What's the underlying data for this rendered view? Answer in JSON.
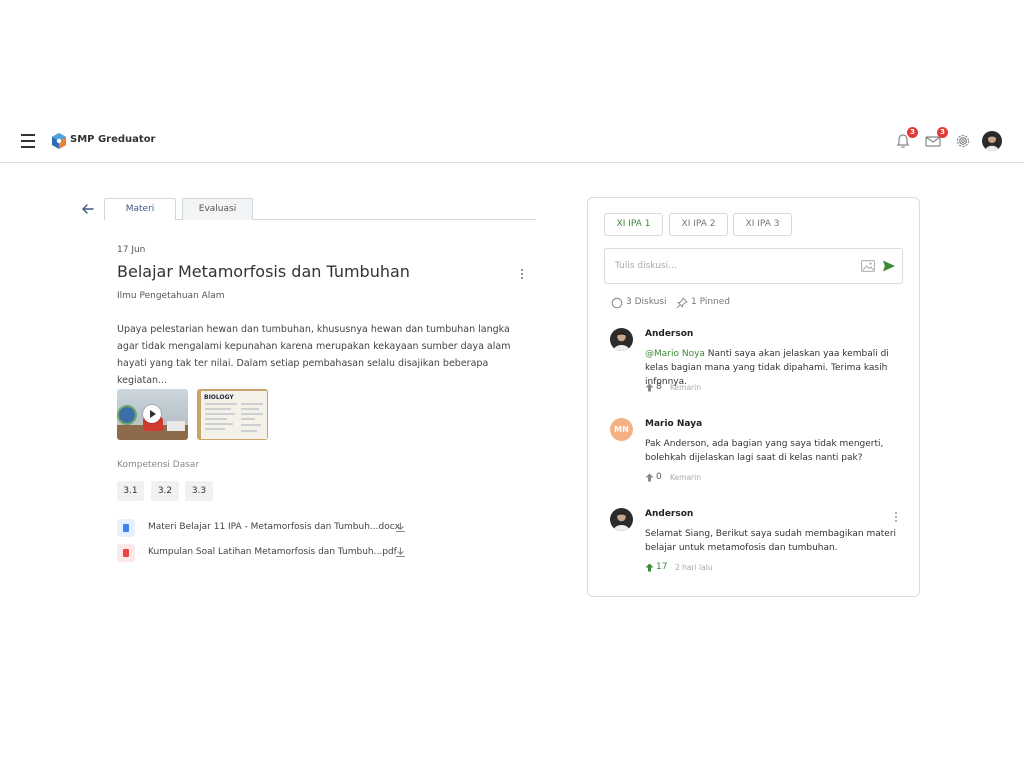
{
  "header": {
    "app_title": "SMP Greduator",
    "notifications_count": "3",
    "messages_count": "3"
  },
  "tabs": [
    {
      "label": "Materi",
      "active": true
    },
    {
      "label": "Evaluasi",
      "active": false
    }
  ],
  "material": {
    "date": "17 Jun",
    "title": "Belajar Metamorfosis dan Tumbuhan",
    "subject": "Ilmu Pengetahuan Alam",
    "description": "Upaya pelestarian hewan dan tumbuhan, khususnya hewan dan tumbuhan langka agar tidak mengalami kepunahan karena merupakan kekayaan sumber daya alam hayati yang tak ter nilai. Dalam setiap pembahasan selalu disajikan beberapa kegiatan...",
    "thumb_text": "BIOLOGY",
    "competency_label": "Kompetensi Dasar",
    "competencies": [
      "3.1",
      "3.2",
      "3.3"
    ],
    "files": [
      {
        "name": "Materi Belajar 11 IPA - Metamorfosis dan Tumbuh...docx",
        "type": "docx",
        "color": "#3b82f6"
      },
      {
        "name": "Kumpulan Soal Latihan Metamorfosis dan Tumbuh...pdf",
        "type": "pdf",
        "color": "#ef4444"
      }
    ]
  },
  "discussion": {
    "class_tabs": [
      {
        "label": "XI IPA 1",
        "active": true
      },
      {
        "label": "XI IPA 2",
        "active": false
      },
      {
        "label": "XI IPA 3",
        "active": false
      }
    ],
    "input_placeholder": "Tulis diskusi...",
    "count_label": "3 Diskusi",
    "pinned_label": "1 Pinned",
    "comments": [
      {
        "name": "Anderson",
        "mention": "@Mario Noya",
        "text": " Nanti saya akan jelaskan yaa kembali di kelas bagian mana yang tidak dipahami. Terima kasih infonnya.",
        "votes": "8",
        "time": "Kemarin"
      },
      {
        "name": "Mario Naya",
        "initials": "MN",
        "text": "Pak Anderson, ada bagian yang saya tidak mengerti, bolehkah dijelaskan lagi saat di kelas nanti pak?",
        "votes": "0",
        "time": "Kemarin"
      },
      {
        "name": "Anderson",
        "text": "Selamat Siang, Berikut saya sudah membagikan materi belajar untuk metamofosis dan tumbuhan.",
        "votes": "17",
        "time": "2 hari lalu"
      }
    ]
  },
  "colors": {
    "accent_green": "#3b8a36",
    "badge_red": "#e53935",
    "primary_blue": "#3d5a80"
  }
}
